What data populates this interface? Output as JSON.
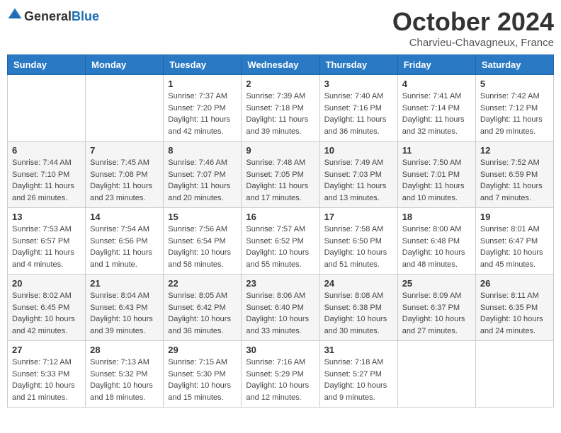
{
  "header": {
    "logo_general": "General",
    "logo_blue": "Blue",
    "month_title": "October 2024",
    "subtitle": "Charvieu-Chavagneux, France"
  },
  "days_of_week": [
    "Sunday",
    "Monday",
    "Tuesday",
    "Wednesday",
    "Thursday",
    "Friday",
    "Saturday"
  ],
  "weeks": [
    [
      {
        "day": "",
        "sunrise": "",
        "sunset": "",
        "daylight": ""
      },
      {
        "day": "",
        "sunrise": "",
        "sunset": "",
        "daylight": ""
      },
      {
        "day": "1",
        "sunrise": "Sunrise: 7:37 AM",
        "sunset": "Sunset: 7:20 PM",
        "daylight": "Daylight: 11 hours and 42 minutes."
      },
      {
        "day": "2",
        "sunrise": "Sunrise: 7:39 AM",
        "sunset": "Sunset: 7:18 PM",
        "daylight": "Daylight: 11 hours and 39 minutes."
      },
      {
        "day": "3",
        "sunrise": "Sunrise: 7:40 AM",
        "sunset": "Sunset: 7:16 PM",
        "daylight": "Daylight: 11 hours and 36 minutes."
      },
      {
        "day": "4",
        "sunrise": "Sunrise: 7:41 AM",
        "sunset": "Sunset: 7:14 PM",
        "daylight": "Daylight: 11 hours and 32 minutes."
      },
      {
        "day": "5",
        "sunrise": "Sunrise: 7:42 AM",
        "sunset": "Sunset: 7:12 PM",
        "daylight": "Daylight: 11 hours and 29 minutes."
      }
    ],
    [
      {
        "day": "6",
        "sunrise": "Sunrise: 7:44 AM",
        "sunset": "Sunset: 7:10 PM",
        "daylight": "Daylight: 11 hours and 26 minutes."
      },
      {
        "day": "7",
        "sunrise": "Sunrise: 7:45 AM",
        "sunset": "Sunset: 7:08 PM",
        "daylight": "Daylight: 11 hours and 23 minutes."
      },
      {
        "day": "8",
        "sunrise": "Sunrise: 7:46 AM",
        "sunset": "Sunset: 7:07 PM",
        "daylight": "Daylight: 11 hours and 20 minutes."
      },
      {
        "day": "9",
        "sunrise": "Sunrise: 7:48 AM",
        "sunset": "Sunset: 7:05 PM",
        "daylight": "Daylight: 11 hours and 17 minutes."
      },
      {
        "day": "10",
        "sunrise": "Sunrise: 7:49 AM",
        "sunset": "Sunset: 7:03 PM",
        "daylight": "Daylight: 11 hours and 13 minutes."
      },
      {
        "day": "11",
        "sunrise": "Sunrise: 7:50 AM",
        "sunset": "Sunset: 7:01 PM",
        "daylight": "Daylight: 11 hours and 10 minutes."
      },
      {
        "day": "12",
        "sunrise": "Sunrise: 7:52 AM",
        "sunset": "Sunset: 6:59 PM",
        "daylight": "Daylight: 11 hours and 7 minutes."
      }
    ],
    [
      {
        "day": "13",
        "sunrise": "Sunrise: 7:53 AM",
        "sunset": "Sunset: 6:57 PM",
        "daylight": "Daylight: 11 hours and 4 minutes."
      },
      {
        "day": "14",
        "sunrise": "Sunrise: 7:54 AM",
        "sunset": "Sunset: 6:56 PM",
        "daylight": "Daylight: 11 hours and 1 minute."
      },
      {
        "day": "15",
        "sunrise": "Sunrise: 7:56 AM",
        "sunset": "Sunset: 6:54 PM",
        "daylight": "Daylight: 10 hours and 58 minutes."
      },
      {
        "day": "16",
        "sunrise": "Sunrise: 7:57 AM",
        "sunset": "Sunset: 6:52 PM",
        "daylight": "Daylight: 10 hours and 55 minutes."
      },
      {
        "day": "17",
        "sunrise": "Sunrise: 7:58 AM",
        "sunset": "Sunset: 6:50 PM",
        "daylight": "Daylight: 10 hours and 51 minutes."
      },
      {
        "day": "18",
        "sunrise": "Sunrise: 8:00 AM",
        "sunset": "Sunset: 6:48 PM",
        "daylight": "Daylight: 10 hours and 48 minutes."
      },
      {
        "day": "19",
        "sunrise": "Sunrise: 8:01 AM",
        "sunset": "Sunset: 6:47 PM",
        "daylight": "Daylight: 10 hours and 45 minutes."
      }
    ],
    [
      {
        "day": "20",
        "sunrise": "Sunrise: 8:02 AM",
        "sunset": "Sunset: 6:45 PM",
        "daylight": "Daylight: 10 hours and 42 minutes."
      },
      {
        "day": "21",
        "sunrise": "Sunrise: 8:04 AM",
        "sunset": "Sunset: 6:43 PM",
        "daylight": "Daylight: 10 hours and 39 minutes."
      },
      {
        "day": "22",
        "sunrise": "Sunrise: 8:05 AM",
        "sunset": "Sunset: 6:42 PM",
        "daylight": "Daylight: 10 hours and 36 minutes."
      },
      {
        "day": "23",
        "sunrise": "Sunrise: 8:06 AM",
        "sunset": "Sunset: 6:40 PM",
        "daylight": "Daylight: 10 hours and 33 minutes."
      },
      {
        "day": "24",
        "sunrise": "Sunrise: 8:08 AM",
        "sunset": "Sunset: 6:38 PM",
        "daylight": "Daylight: 10 hours and 30 minutes."
      },
      {
        "day": "25",
        "sunrise": "Sunrise: 8:09 AM",
        "sunset": "Sunset: 6:37 PM",
        "daylight": "Daylight: 10 hours and 27 minutes."
      },
      {
        "day": "26",
        "sunrise": "Sunrise: 8:11 AM",
        "sunset": "Sunset: 6:35 PM",
        "daylight": "Daylight: 10 hours and 24 minutes."
      }
    ],
    [
      {
        "day": "27",
        "sunrise": "Sunrise: 7:12 AM",
        "sunset": "Sunset: 5:33 PM",
        "daylight": "Daylight: 10 hours and 21 minutes."
      },
      {
        "day": "28",
        "sunrise": "Sunrise: 7:13 AM",
        "sunset": "Sunset: 5:32 PM",
        "daylight": "Daylight: 10 hours and 18 minutes."
      },
      {
        "day": "29",
        "sunrise": "Sunrise: 7:15 AM",
        "sunset": "Sunset: 5:30 PM",
        "daylight": "Daylight: 10 hours and 15 minutes."
      },
      {
        "day": "30",
        "sunrise": "Sunrise: 7:16 AM",
        "sunset": "Sunset: 5:29 PM",
        "daylight": "Daylight: 10 hours and 12 minutes."
      },
      {
        "day": "31",
        "sunrise": "Sunrise: 7:18 AM",
        "sunset": "Sunset: 5:27 PM",
        "daylight": "Daylight: 10 hours and 9 minutes."
      },
      {
        "day": "",
        "sunrise": "",
        "sunset": "",
        "daylight": ""
      },
      {
        "day": "",
        "sunrise": "",
        "sunset": "",
        "daylight": ""
      }
    ]
  ]
}
